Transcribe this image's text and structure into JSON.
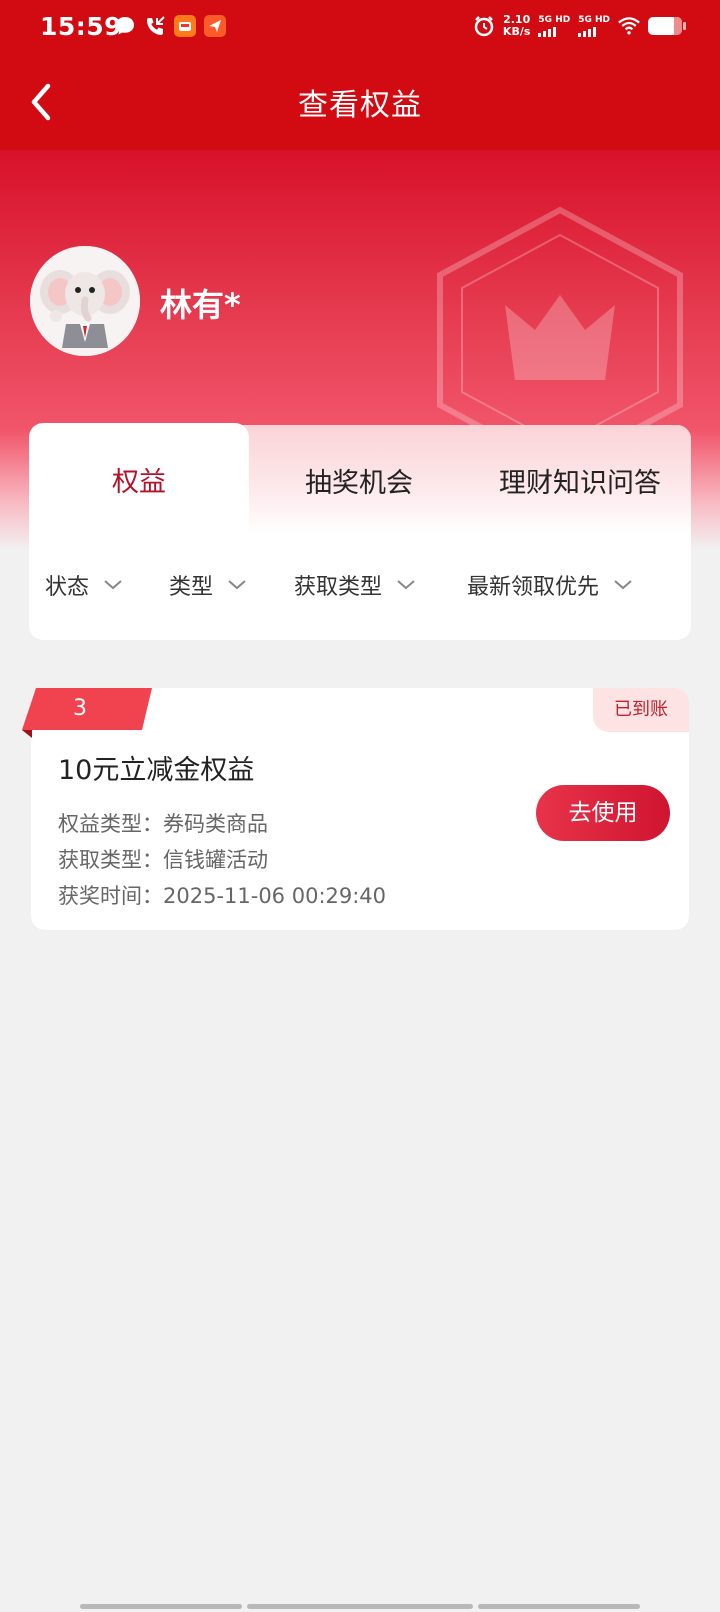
{
  "status_bar": {
    "time": "15:59",
    "net_speed_value": "2.10",
    "net_speed_unit": "KB/s",
    "signal_1": "5G HD",
    "signal_2": "5G HD"
  },
  "nav": {
    "title": "查看权益"
  },
  "profile": {
    "name": "林有*"
  },
  "tabs": [
    {
      "label": "权益",
      "active": true
    },
    {
      "label": "抽奖机会",
      "active": false
    },
    {
      "label": "理财知识问答",
      "active": false
    }
  ],
  "filters": [
    {
      "label": "状态"
    },
    {
      "label": "类型"
    },
    {
      "label": "获取类型"
    },
    {
      "label": "最新领取优先"
    }
  ],
  "reward": {
    "rank": "3",
    "status": "已到账",
    "title": "10元立减金权益",
    "type_line": "权益类型：券码类商品",
    "source_line": "获取类型：信钱罐活动",
    "time_line": "获奖时间：2025-11-06 00:29:40",
    "action_label": "去使用"
  },
  "colors": {
    "brand_red": "#d20a12",
    "active_tab_text": "#b4122a",
    "button_red": "#d91e38",
    "page_bg": "#f1f1f1"
  }
}
